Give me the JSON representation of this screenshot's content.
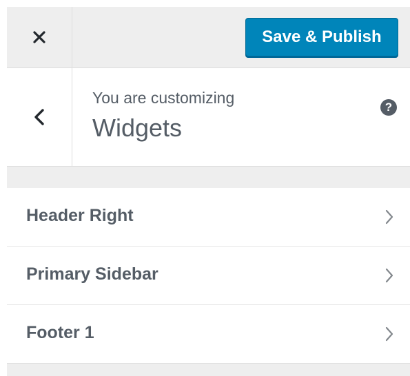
{
  "topbar": {
    "close_icon": "close-icon",
    "save_label": "Save & Publish",
    "accent": "#0085ba"
  },
  "info": {
    "back_icon": "chevron-left-icon",
    "pre_title": "You are customizing",
    "title": "Widgets",
    "help_symbol": "?"
  },
  "sections": [
    {
      "label": "Header Right"
    },
    {
      "label": "Primary Sidebar"
    },
    {
      "label": "Footer 1"
    }
  ]
}
